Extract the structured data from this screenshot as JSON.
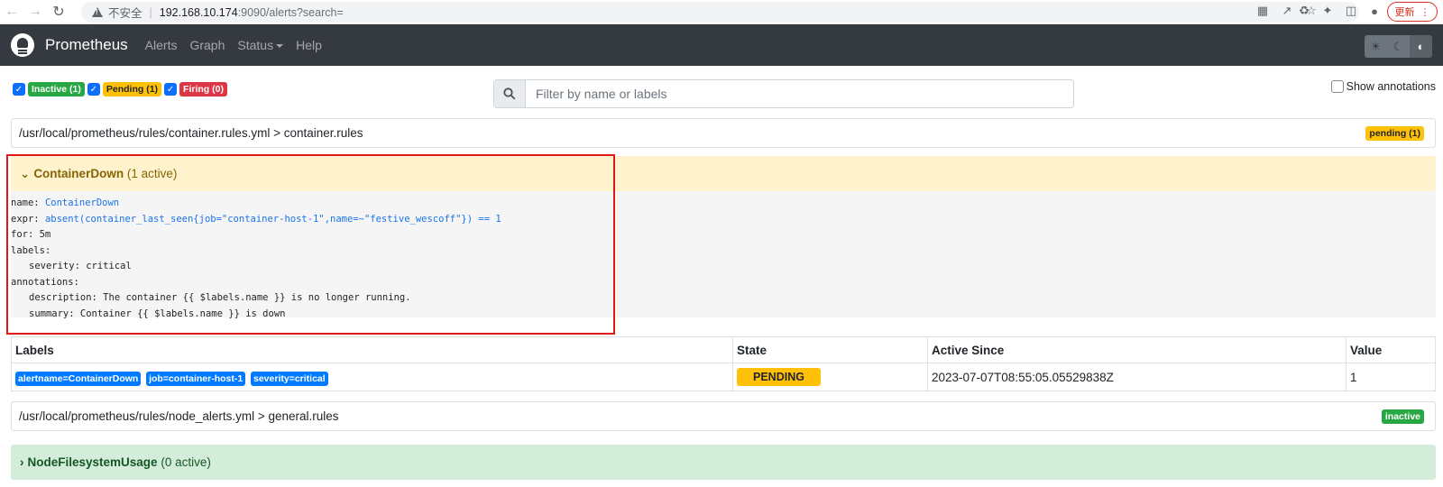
{
  "browser": {
    "insecure_label": "不安全",
    "url_host": "192.168.10.174",
    "url_rest": ":9090/alerts?search=",
    "update_label": "更新"
  },
  "navbar": {
    "brand": "Prometheus",
    "links": [
      "Alerts",
      "Graph",
      "Status",
      "Help"
    ]
  },
  "filters": {
    "inactive": "Inactive (1)",
    "pending": "Pending (1)",
    "firing": "Firing (0)",
    "search_placeholder": "Filter by name or labels",
    "show_annotations": "Show annotations"
  },
  "groups": [
    {
      "path": "/usr/local/prometheus/rules/container.rules.yml > container.rules",
      "badge": "pending (1)",
      "rule": {
        "name": "ContainerDown",
        "active": "(1 active)",
        "code": {
          "name_key": "name:",
          "name_val": "ContainerDown",
          "expr_key": "expr:",
          "expr_val": "absent(container_last_seen{job=\"container-host-1\",name=~\"festive_wescoff\"}) == 1",
          "for_line": "for: 5m",
          "labels_line": "labels:",
          "severity_line": "severity: critical",
          "annotations_line": "annotations:",
          "description_line": "description: The container {{ $labels.name }} is no longer running.",
          "summary_line": "summary: Container {{ $labels.name }} is down"
        },
        "table": {
          "headers": [
            "Labels",
            "State",
            "Active Since",
            "Value"
          ],
          "row": {
            "labels": [
              "alertname=ContainerDown",
              "job=container-host-1",
              "severity=critical"
            ],
            "state": "PENDING",
            "active_since": "2023-07-07T08:55:05.05529838Z",
            "value": "1"
          }
        }
      }
    },
    {
      "path": "/usr/local/prometheus/rules/node_alerts.yml > general.rules",
      "badge": "inactive",
      "rule": {
        "name": "NodeFilesystemUsage",
        "active": "(0 active)"
      }
    }
  ]
}
